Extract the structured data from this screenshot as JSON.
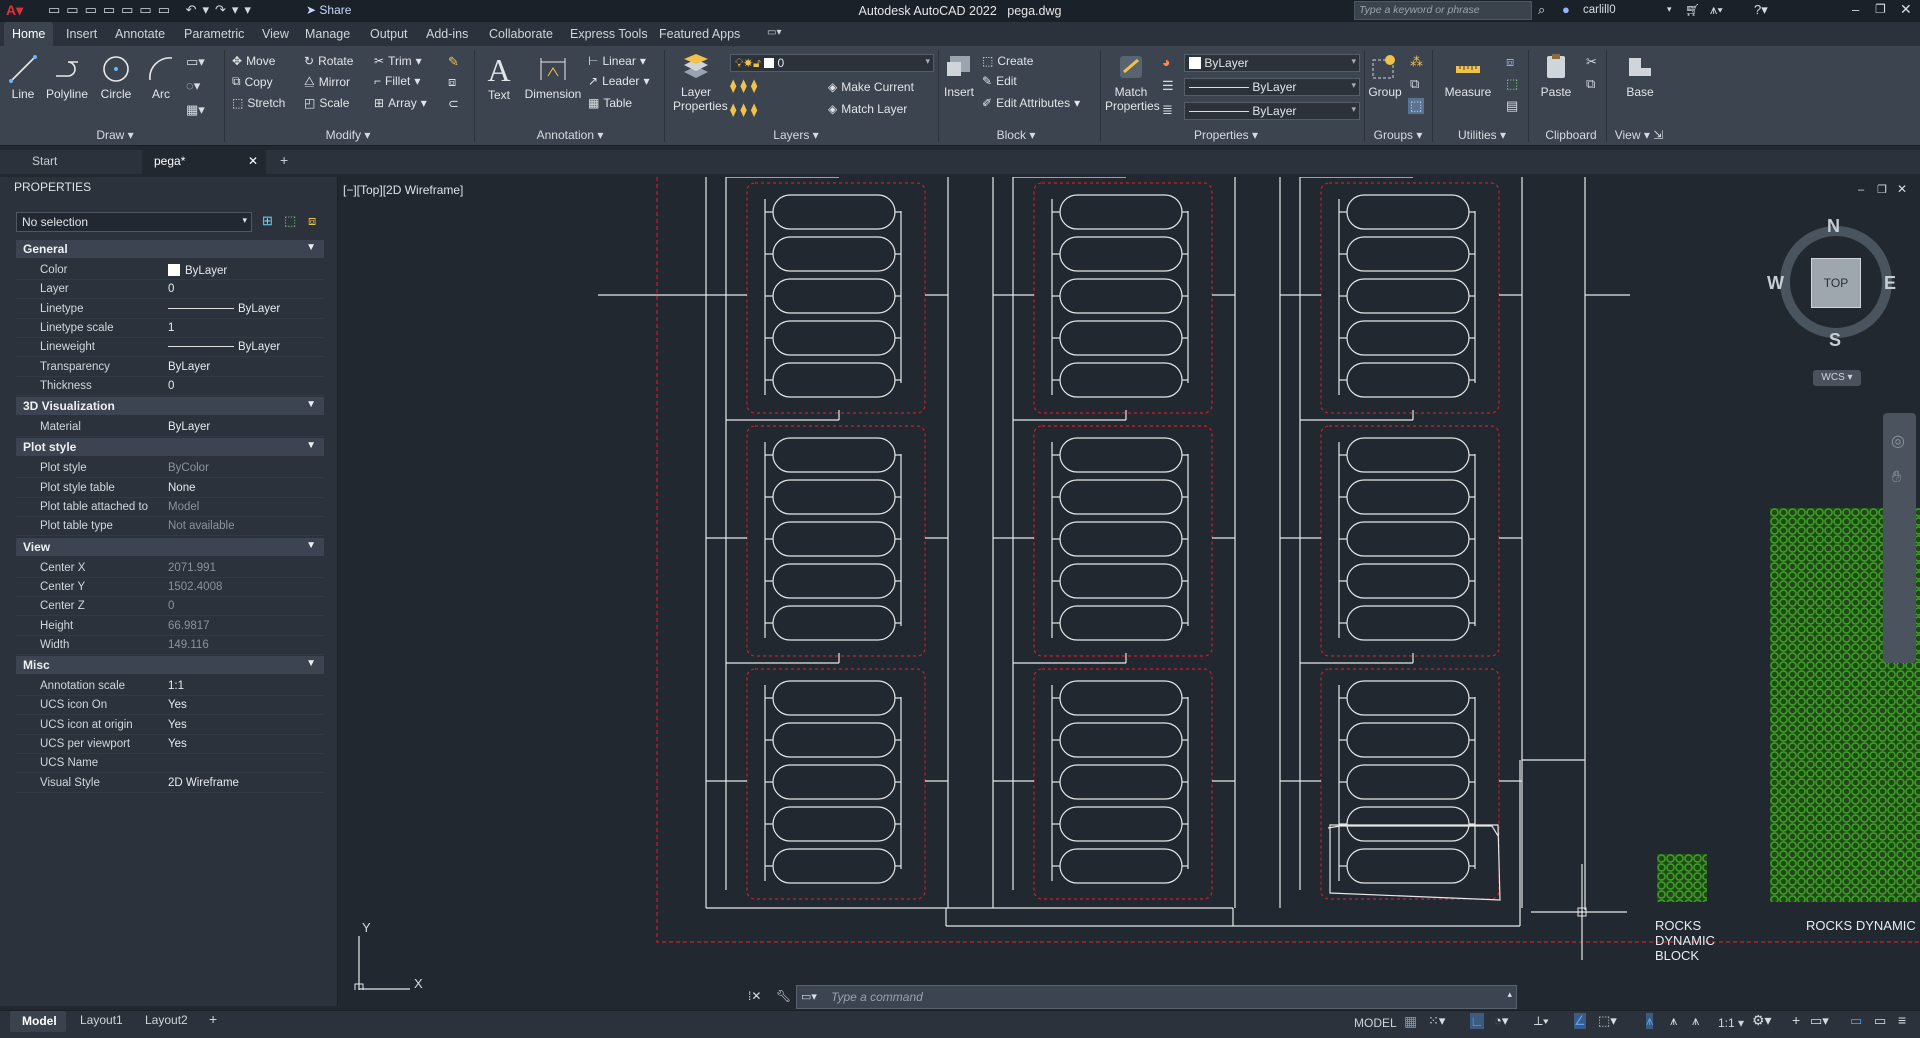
{
  "titlebar": {
    "app": "Autodesk AutoCAD 2022",
    "file": "pega.dwg",
    "share": "Share",
    "search_placeholder": "Type a keyword or phrase",
    "user": "carlill0"
  },
  "ribbon_tabs": [
    "Home",
    "Insert",
    "Annotate",
    "Parametric",
    "View",
    "Manage",
    "Output",
    "Add-ins",
    "Collaborate",
    "Express Tools",
    "Featured Apps"
  ],
  "ribbon": {
    "draw": {
      "title": "Draw",
      "line": "Line",
      "polyline": "Polyline",
      "circle": "Circle",
      "arc": "Arc"
    },
    "modify": {
      "title": "Modify",
      "move": "Move",
      "rotate": "Rotate",
      "trim": "Trim",
      "copy": "Copy",
      "mirror": "Mirror",
      "fillet": "Fillet",
      "stretch": "Stretch",
      "scale": "Scale",
      "array": "Array"
    },
    "annotation": {
      "title": "Annotation",
      "text": "Text",
      "dimension": "Dimension",
      "linear": "Linear",
      "leader": "Leader",
      "table": "Table"
    },
    "layers": {
      "title": "Layers",
      "layer_properties": "Layer Properties",
      "current_layer": "0",
      "make_current": "Make Current",
      "match_layer": "Match Layer"
    },
    "block": {
      "title": "Block",
      "insert": "Insert",
      "create": "Create",
      "edit": "Edit",
      "edit_attributes": "Edit Attributes"
    },
    "properties": {
      "title": "Properties",
      "match_properties": "Match Properties",
      "color": "ByLayer",
      "linetype": "ByLayer",
      "lineweight": "ByLayer"
    },
    "groups": {
      "title": "Groups",
      "group": "Group"
    },
    "utilities": {
      "title": "Utilities",
      "measure": "Measure"
    },
    "clipboard": {
      "title": "Clipboard",
      "paste": "Paste"
    },
    "view": {
      "title": "View",
      "base": "Base"
    }
  },
  "doc_tabs": [
    "Start",
    "pega*"
  ],
  "properties_palette": {
    "title": "PROPERTIES",
    "selection": "No selection",
    "sections": [
      {
        "name": "General",
        "rows": [
          [
            "Color",
            "ByLayer"
          ],
          [
            "Layer",
            "0"
          ],
          [
            "Linetype",
            "ByLayer"
          ],
          [
            "Linetype scale",
            "1"
          ],
          [
            "Lineweight",
            "ByLayer"
          ],
          [
            "Transparency",
            "ByLayer"
          ],
          [
            "Thickness",
            "0"
          ]
        ]
      },
      {
        "name": "3D Visualization",
        "rows": [
          [
            "Material",
            "ByLayer"
          ]
        ]
      },
      {
        "name": "Plot style",
        "rows": [
          [
            "Plot style",
            "ByColor"
          ],
          [
            "Plot style table",
            "None"
          ],
          [
            "Plot table attached to",
            "Model"
          ],
          [
            "Plot table type",
            "Not available"
          ]
        ]
      },
      {
        "name": "View",
        "rows": [
          [
            "Center X",
            "2071.991"
          ],
          [
            "Center Y",
            "1502.4008"
          ],
          [
            "Center Z",
            "0"
          ],
          [
            "Height",
            "66.9817"
          ],
          [
            "Width",
            "149.116"
          ]
        ]
      },
      {
        "name": "Misc",
        "rows": [
          [
            "Annotation scale",
            "1:1"
          ],
          [
            "UCS icon On",
            "Yes"
          ],
          [
            "UCS icon at origin",
            "Yes"
          ],
          [
            "UCS per viewport",
            "Yes"
          ],
          [
            "UCS Name",
            ""
          ],
          [
            "Visual Style",
            "2D Wireframe"
          ]
        ]
      }
    ]
  },
  "viewport": {
    "label": "[−][Top][2D Wireframe]",
    "viewcube": {
      "top": "TOP",
      "n": "N",
      "s": "S",
      "e": "E",
      "w": "W",
      "wcs": "WCS"
    },
    "block_labels": [
      "ROCKS\nDYNAMIC\nBLOCK",
      "ROCKS DYNAMIC B"
    ],
    "ucs_x": "X",
    "ucs_y": "Y"
  },
  "command_line": {
    "placeholder": "Type  a  command"
  },
  "layout_tabs": [
    "Model",
    "Layout1",
    "Layout2"
  ],
  "status_bar": {
    "model": "MODEL",
    "scale": "1:1"
  },
  "colors": {
    "background": "#212830",
    "wire": "#e8e8e8",
    "red_dashed": "#c8202a",
    "hatch": "#3fa12b"
  }
}
